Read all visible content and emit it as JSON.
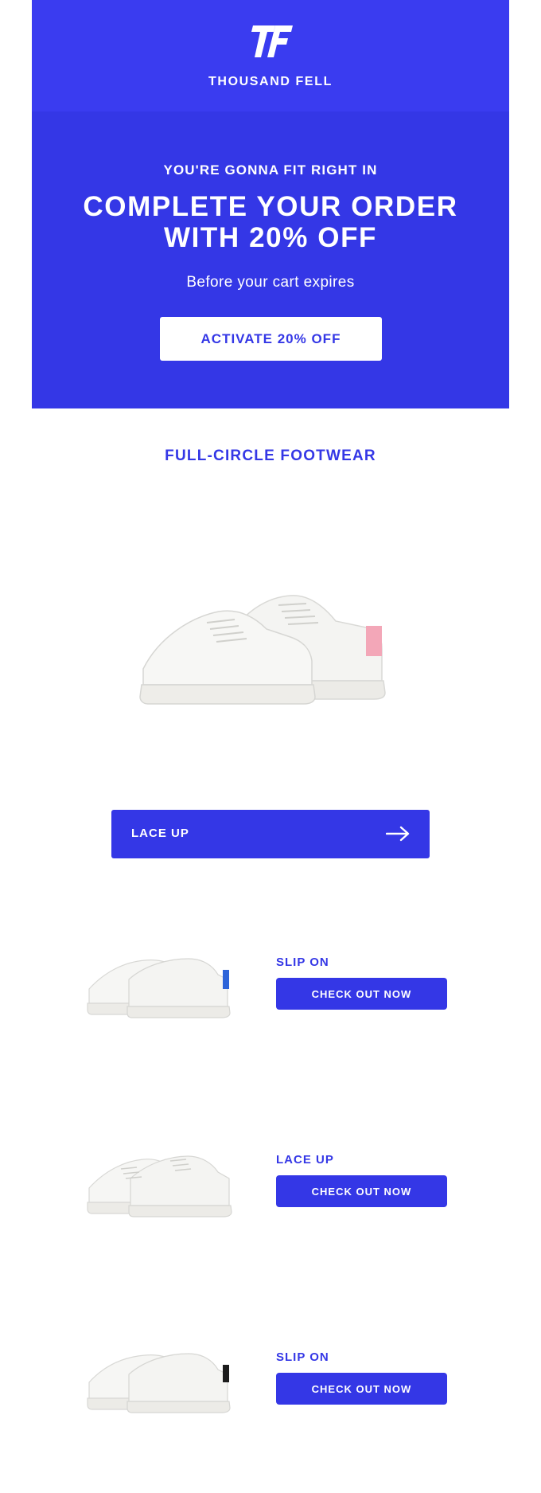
{
  "brand": {
    "logo_icon": "thousand-fell-tf-logo-icon",
    "name": "THOUSAND FELL"
  },
  "hero": {
    "eyebrow": "YOU'RE GONNA FIT RIGHT IN",
    "headline": "COMPLETE YOUR ORDER WITH 20% OFF",
    "subline": "Before your cart expires",
    "cta_label": "ACTIVATE 20% OFF"
  },
  "section": {
    "title": "FULL-CIRCLE FOOTWEAR"
  },
  "featured": {
    "image_icon": "lace-up-sneaker-pair-icon",
    "accent": "#f3a7b8",
    "button_label": "LACE UP",
    "arrow_icon": "arrow-right-icon"
  },
  "products": [
    {
      "name": "SLIP ON",
      "button_label": "CHECK OUT NOW",
      "image_icon": "slip-on-sneaker-pair-icon",
      "accent": "#2d64d9"
    },
    {
      "name": "LACE UP",
      "button_label": "CHECK OUT NOW",
      "image_icon": "lace-up-sneaker-pair-icon",
      "accent": "#eeeeee"
    },
    {
      "name": "SLIP ON",
      "button_label": "CHECK OUT NOW",
      "image_icon": "slip-on-sneaker-pair-icon",
      "accent": "#1c1c1c"
    }
  ],
  "colors": {
    "brand_blue": "#3437e6",
    "header_blue": "#3a3cf0",
    "white": "#ffffff"
  }
}
